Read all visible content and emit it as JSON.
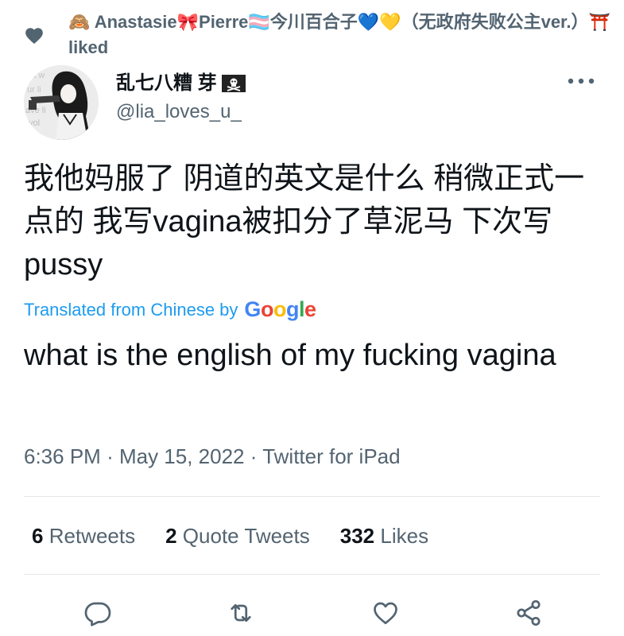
{
  "context": {
    "liked_by_text": "🙈 Anastasie🎀Pierre🏳️‍⚧️今川百合子💙💛（无政府失败公主ver.）⛩️ liked"
  },
  "author": {
    "display_name": "乱七八糟 芽",
    "handle": "@lia_loves_u_"
  },
  "tweet": {
    "text": "我他妈服了 阴道的英文是什么 稍微正式一点的 我写vagina被扣分了草泥马 下次写pussy",
    "translated_label": "Translated from Chinese by",
    "translation_provider": "Google",
    "translation": "what is the english of my fucking vagina",
    "time": "6:36 PM",
    "date": "May 15, 2022",
    "source": "Twitter for iPad",
    "separator": "·"
  },
  "stats": {
    "retweets_count": "6",
    "retweets_label": "Retweets",
    "quotes_count": "2",
    "quotes_label": "Quote Tweets",
    "likes_count": "332",
    "likes_label": "Likes"
  },
  "actions": {
    "reply_icon": "reply-icon",
    "retweet_icon": "retweet-icon",
    "like_icon": "heart-icon",
    "share_icon": "share-icon"
  },
  "colors": {
    "accent": "#1d9bf0",
    "secondary_text": "#536471",
    "primary_text": "#0f1419"
  }
}
